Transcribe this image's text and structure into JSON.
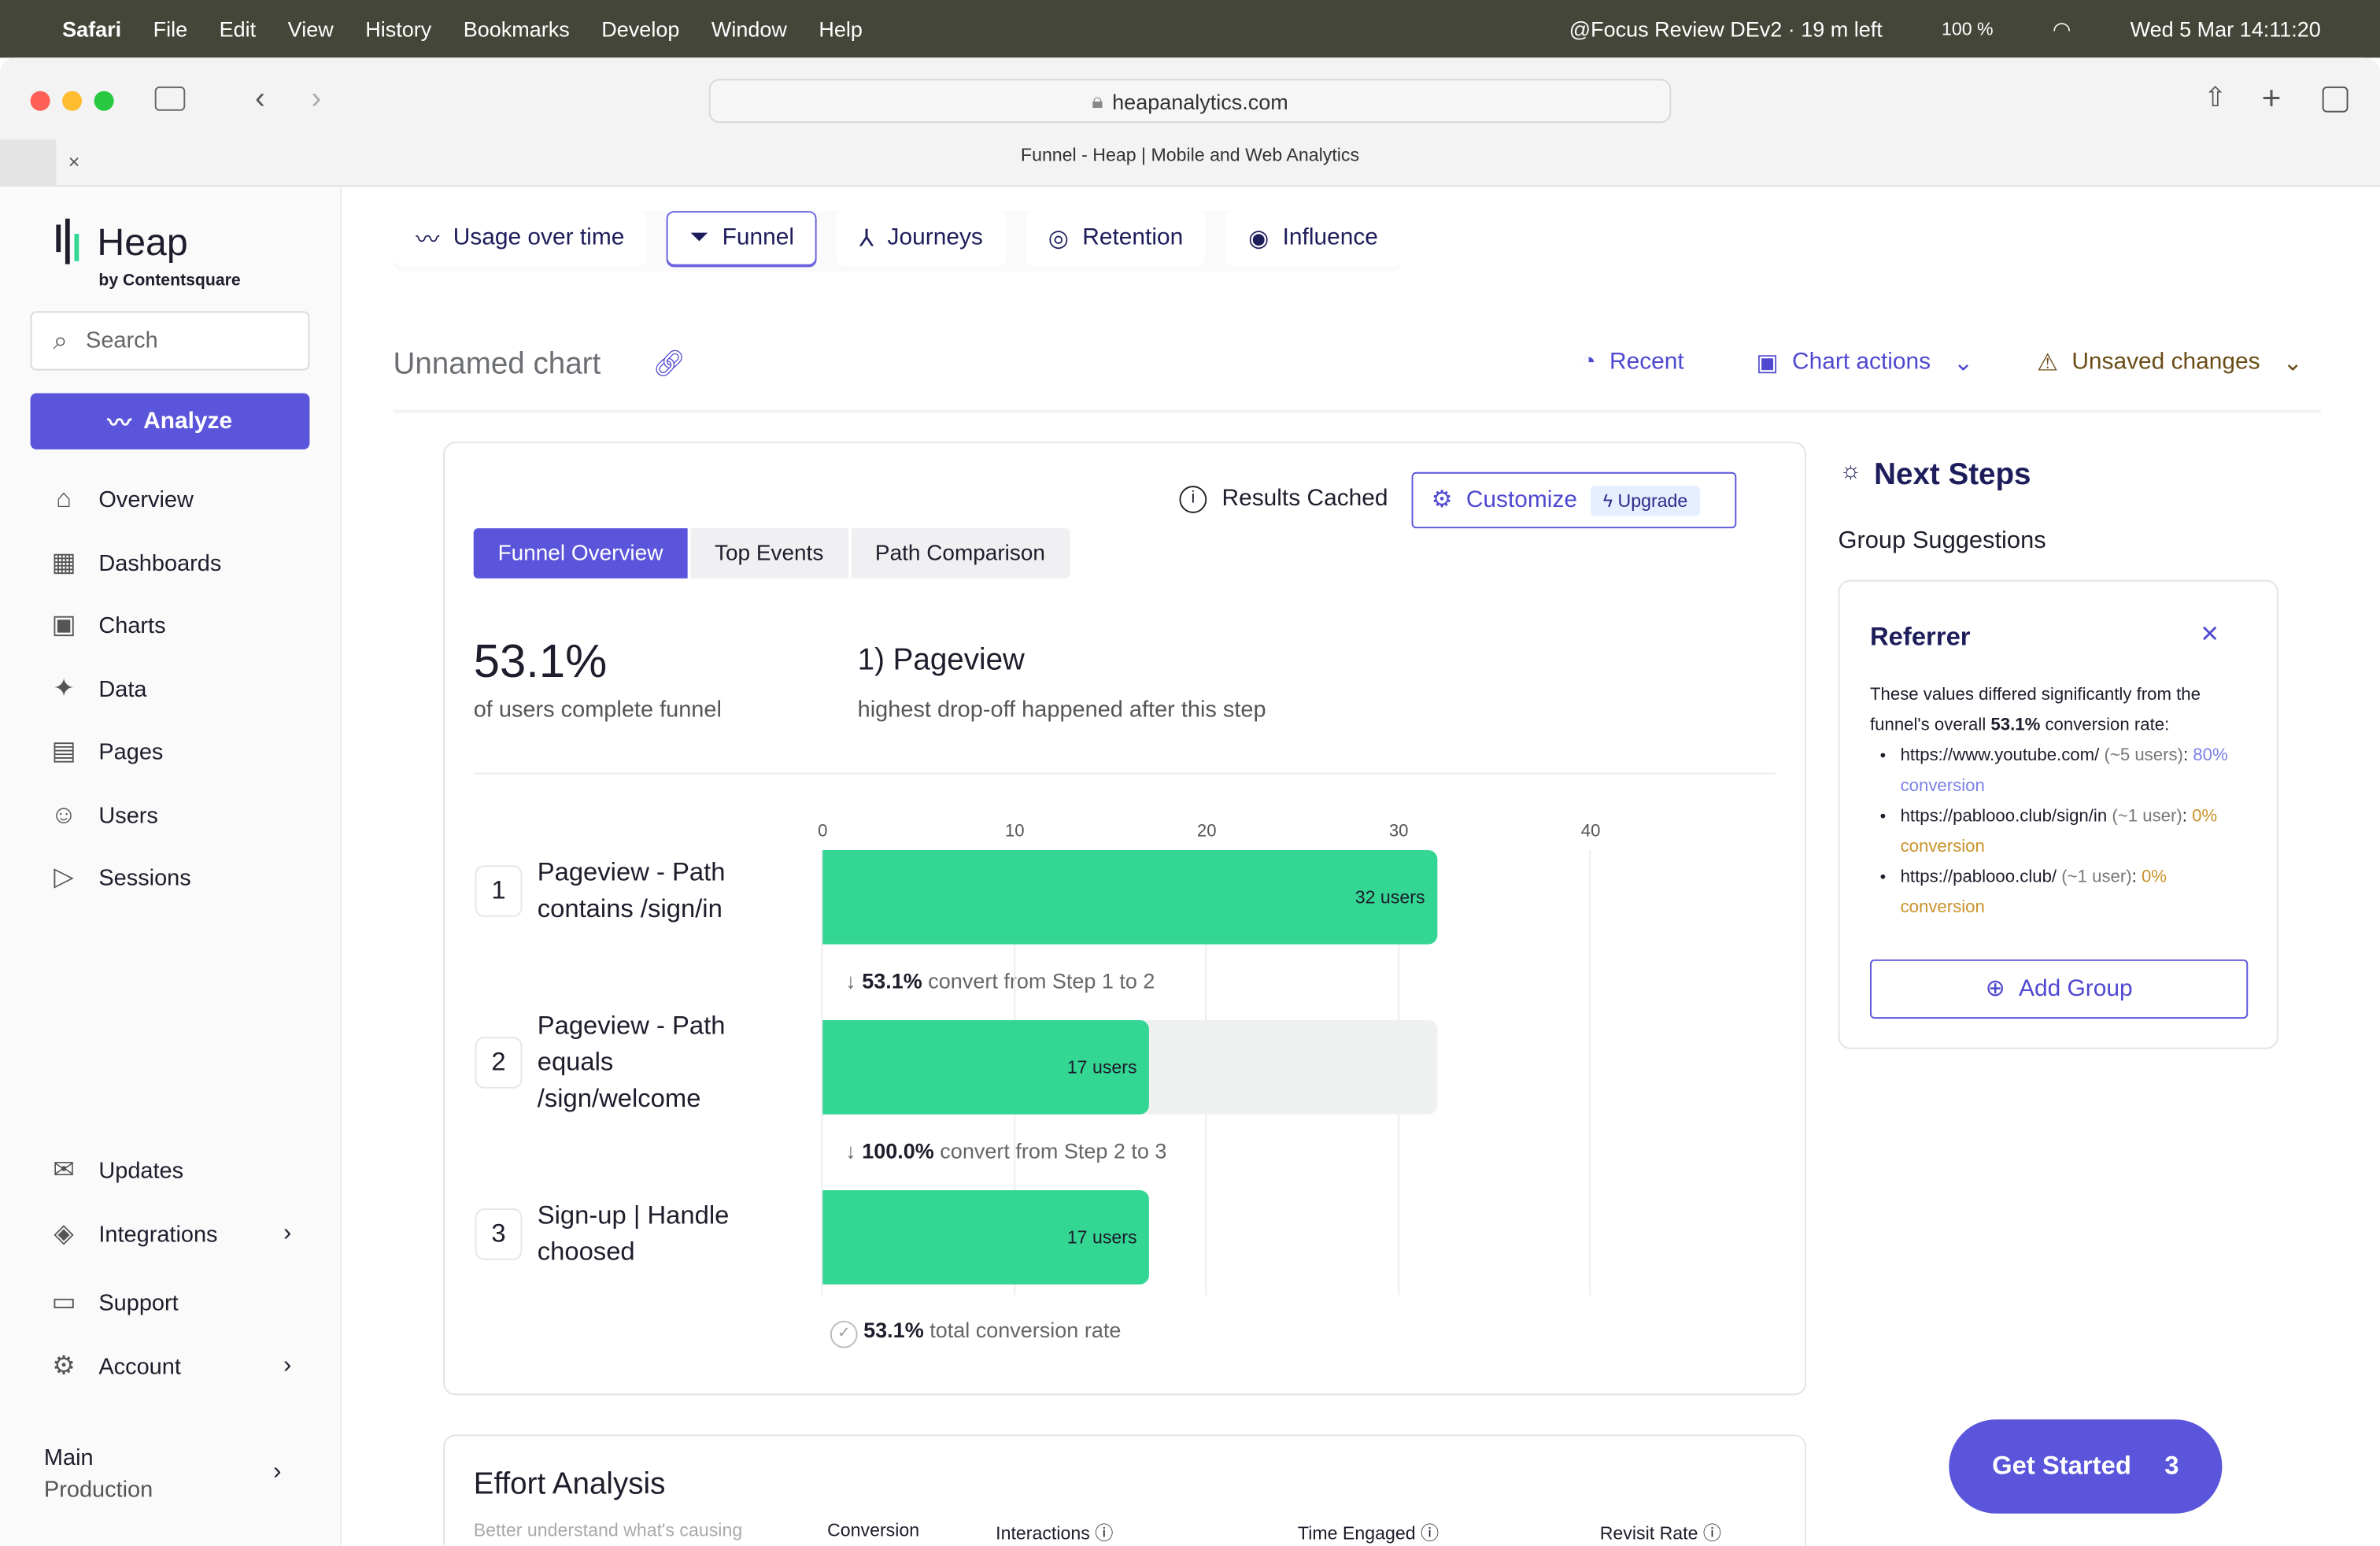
{
  "menubar": {
    "app": "Safari",
    "items": [
      "File",
      "Edit",
      "View",
      "History",
      "Bookmarks",
      "Develop",
      "Window",
      "Help"
    ],
    "focus": "@Focus Review DEv2 · 19 m left",
    "battery": "100 %",
    "datetime": "Wed 5 Mar  14:11:20"
  },
  "browser": {
    "url": "heapanalytics.com",
    "tab_title": "Funnel - Heap | Mobile and Web Analytics"
  },
  "sidebar": {
    "brand": "Heap",
    "brand_sub": "by Contentsquare",
    "search_placeholder": "Search",
    "analyze": "Analyze",
    "items": [
      {
        "label": "Overview",
        "icon": "home-icon"
      },
      {
        "label": "Dashboards",
        "icon": "grid-icon"
      },
      {
        "label": "Charts",
        "icon": "chart-icon"
      },
      {
        "label": "Data",
        "icon": "sparkle-icon"
      },
      {
        "label": "Pages",
        "icon": "pages-icon"
      },
      {
        "label": "Users",
        "icon": "users-icon"
      },
      {
        "label": "Sessions",
        "icon": "play-icon"
      }
    ],
    "bottom": [
      {
        "label": "Updates",
        "icon": "megaphone-icon"
      },
      {
        "label": "Integrations",
        "icon": "layers-icon"
      },
      {
        "label": "Support",
        "icon": "chat-icon"
      },
      {
        "label": "Account",
        "icon": "gear-icon"
      }
    ],
    "env": {
      "name": "Main",
      "sub": "Production"
    }
  },
  "chart_tabs": [
    "Usage over time",
    "Funnel",
    "Journeys",
    "Retention",
    "Influence"
  ],
  "header": {
    "title": "Unnamed chart",
    "recent": "Recent",
    "chart_actions": "Chart actions",
    "unsaved": "Unsaved changes"
  },
  "funnel": {
    "results_cached": "Results Cached",
    "customize": "Customize",
    "upgrade": "Upgrade",
    "subtabs": [
      "Funnel Overview",
      "Top Events",
      "Path Comparison"
    ],
    "summary_value": "53.1%",
    "summary_label": "of users complete funnel",
    "dropoff_title": "1) Pageview",
    "dropoff_label": "highest drop-off happened after this step",
    "conversions": [
      {
        "pct": "53.1%",
        "text": "convert from Step 1 to 2"
      },
      {
        "pct": "100.0%",
        "text": "convert from Step 2 to 3"
      }
    ],
    "total": {
      "pct": "53.1%",
      "text": "total conversion rate"
    }
  },
  "chart_data": {
    "type": "bar",
    "orientation": "horizontal",
    "categories": [
      "Pageview - Path contains /sign/in",
      "Pageview - Path equals /sign/welcome",
      "Sign-up | Handle choosed"
    ],
    "step_numbers": [
      "1",
      "2",
      "3"
    ],
    "values": [
      32,
      17,
      17
    ],
    "value_labels": [
      "32 users",
      "17 users",
      "17 users"
    ],
    "xlim": [
      0,
      40
    ],
    "ticks": [
      "0",
      "10",
      "20",
      "30",
      "40"
    ],
    "grid": true,
    "color": "#33d693"
  },
  "next_steps": {
    "title": "Next Steps",
    "group_suggestions": "Group Suggestions",
    "card_title": "Referrer",
    "intro_a": "These values differed significantly from the funnel's overall ",
    "intro_b": "53.1%",
    "intro_c": " conversion rate:",
    "items": [
      {
        "url": "https://www.youtube.com/",
        "users": "(~5 users)",
        "conv": "80% conversion",
        "color": "#7b82e6"
      },
      {
        "url": "https://pablooo.club/sign/in",
        "users": "(~1 user)",
        "conv": "0% conversion",
        "color": "#c9922a"
      },
      {
        "url": "https://pablooo.club/",
        "users": "(~1 user)",
        "conv": "0% conversion",
        "color": "#c9922a"
      }
    ],
    "add_group": "Add Group"
  },
  "effort": {
    "title": "Effort Analysis",
    "subtitle": "Better understand what's causing",
    "cols": [
      "Conversion",
      "Interactions",
      "Time Engaged",
      "Revisit Rate"
    ]
  },
  "get_started": {
    "label": "Get Started",
    "count": "3"
  },
  "colors": {
    "accent": "#5a55da",
    "bar": "#33d693",
    "dark": "#1d1d5c"
  }
}
